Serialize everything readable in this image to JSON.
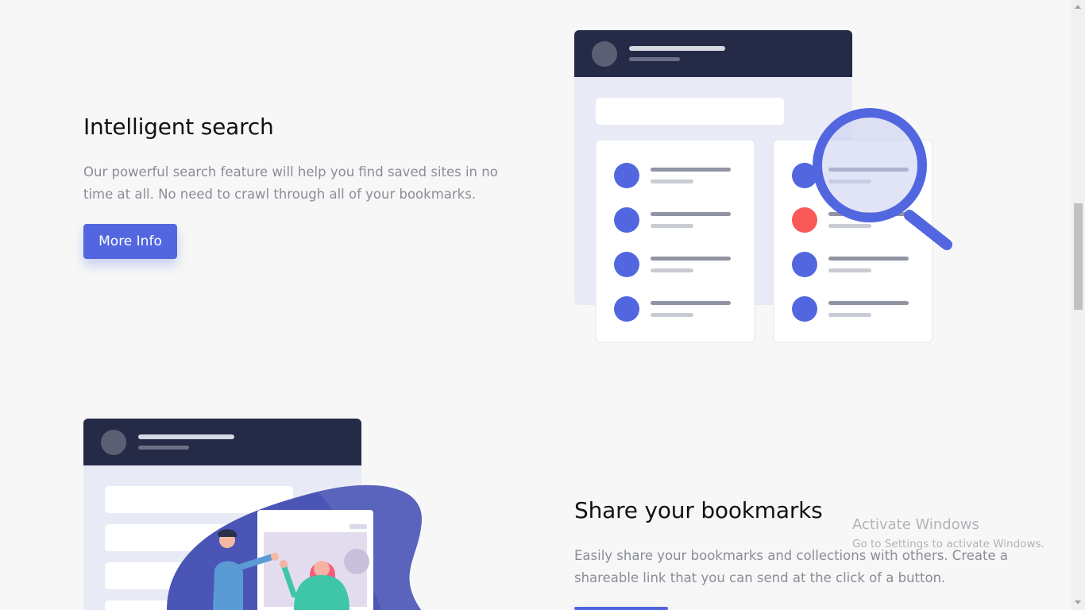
{
  "features": [
    {
      "title": "Intelligent search",
      "description_line1": "Our powerful search feature will help you find saved sites in no",
      "description_line2": "time at all. No need to crawl through all of your bookmarks.",
      "button_label": "More Info"
    },
    {
      "title": "Share your bookmarks",
      "description_line1": "Easily share your bookmarks and collections with others. Create a",
      "description_line2": "shareable link that you can send at the click of a button."
    }
  ],
  "watermark": {
    "title": "Activate Windows",
    "text": "Go to Settings to activate Windows."
  },
  "colors": {
    "accent": "#5267df",
    "dark_navy": "#252b46",
    "alert_red": "#fa5959",
    "text_grey": "#8a8d98",
    "panel_bg": "#e8eaf6"
  },
  "icons": [
    "magnifier-icon",
    "avatar-icon",
    "list-bullet-icon"
  ]
}
